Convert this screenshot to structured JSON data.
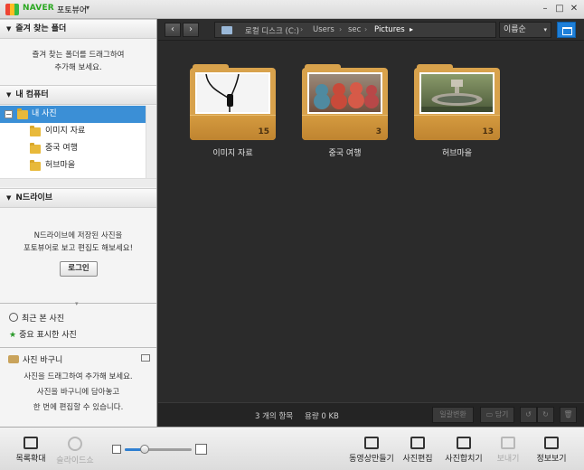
{
  "titlebar": {
    "brand": "NAVER",
    "app_name": "포토뷰어",
    "minimize": "–",
    "maximize": "□",
    "close": "✕"
  },
  "sidebar": {
    "favorites": {
      "title": "즐겨 찾는 폴더",
      "message_line1": "즐겨 찾는 폴더를 드래그하여",
      "message_line2": "추가해 보세요."
    },
    "computer": {
      "title": "내 컴퓨터",
      "tree": [
        {
          "label": "내 사진",
          "selected": true
        },
        {
          "label": "이미지 자료"
        },
        {
          "label": "중국 여행"
        },
        {
          "label": "허브마을"
        }
      ]
    },
    "ndrive": {
      "title": "N드라이브",
      "message_line1": "N드라이브에 저장된 사진을",
      "message_line2": "포토뷰어로 보고 편집도 해보세요!",
      "login_label": "로그인"
    },
    "recent_label": "최근 본 사진",
    "starred_label": "중요 표시한 사진",
    "basket": {
      "title": "사진 바구니",
      "line1": "사진을 드래그하여 추가해 보세요.",
      "line2": "사진을 바구니에 담아놓고",
      "line3": "한 번에 편집할 수 있습니다."
    }
  },
  "toolbar": {
    "back": "‹",
    "forward": "›",
    "path": [
      "로컬 디스크 (C:)",
      "Users",
      "sec",
      "Pictures"
    ],
    "path_sep": "›",
    "path_end": "▸",
    "sort_label": "이름순",
    "sort_caret": "▾"
  },
  "folders": [
    {
      "name": "이미지 자료",
      "count": "15",
      "photo_bg": "#f4f4f4",
      "photo_fg": "#111111"
    },
    {
      "name": "중국 여행",
      "count": "3",
      "photo_bg": "#7d5c4a",
      "photo_fg": "#c94a3a"
    },
    {
      "name": "허브마을",
      "count": "13",
      "photo_bg": "#5b6b48",
      "photo_fg": "#a7a59a"
    }
  ],
  "status": {
    "item_count": "3 개의 항목",
    "size": "용량 0 KB",
    "batch_label": "일괄변환",
    "put_label": "담기"
  },
  "bottom": {
    "list_zoom": "목록확대",
    "slideshow": "슬라이드쇼",
    "zoom_level": 0.3,
    "make_video": "동영상만들기",
    "edit_photo": "사진편집",
    "merge_photo": "사진합치기",
    "send": "보내기",
    "info": "정보보기"
  }
}
